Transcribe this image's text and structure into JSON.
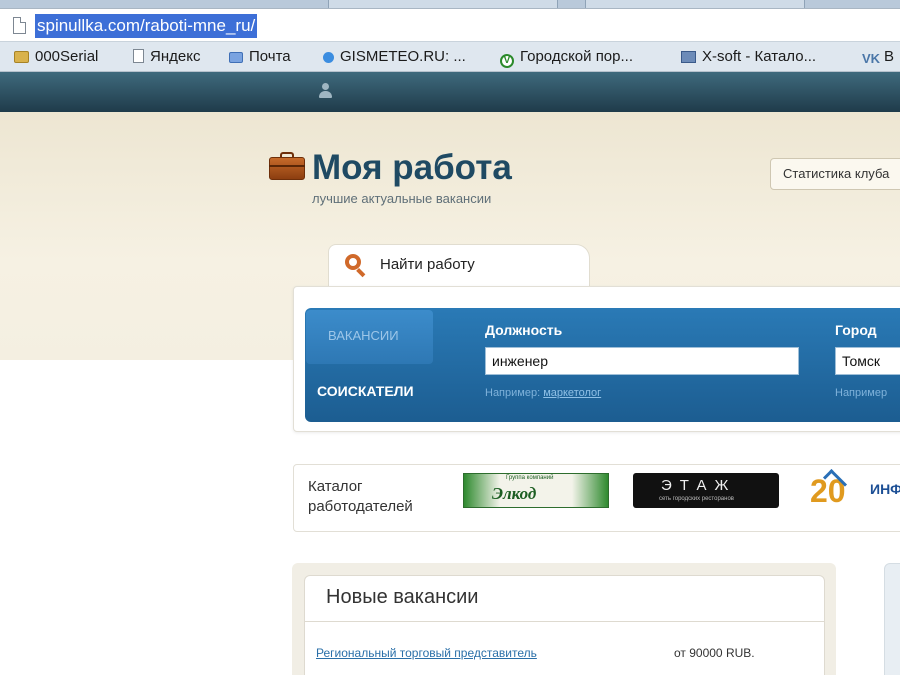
{
  "browser": {
    "url": "spinullka.com/raboti-mne_ru/",
    "bookmarks": [
      {
        "label": "000Serial",
        "icon": "folder-icon"
      },
      {
        "label": "Яндекс",
        "icon": "page-icon"
      },
      {
        "label": "Почта",
        "icon": "mail-icon"
      },
      {
        "label": "GISMETEO.RU: ...",
        "icon": "weather-icon"
      },
      {
        "label": "Городской пор...",
        "icon": "city-portal-icon"
      },
      {
        "label": "X-soft - Катало...",
        "icon": "xsoft-icon"
      },
      {
        "label": "В",
        "icon": "vk-icon"
      }
    ]
  },
  "header": {
    "logo_title": "Моя работа",
    "logo_subtitle": "лучшие актуальные вакансии",
    "stats_button": "Статистика клуба"
  },
  "search": {
    "tab_label": "Найти работу",
    "mode_tabs": {
      "vacancies": "ВАКАНСИИ",
      "seekers": "СОИСКАТЕЛИ"
    },
    "position_label": "Должность",
    "position_value": "инженер",
    "position_hint_prefix": "Например:",
    "position_hint_link": "маркетолог",
    "city_label": "Город",
    "city_value": "Томск",
    "city_hint_prefix": "Например"
  },
  "catalog": {
    "label_line1": "Каталог",
    "label_line2": "работодателей",
    "logos": {
      "elkod": {
        "text": "Элкод",
        "small": "Группа компаний"
      },
      "etaz": {
        "text": "ЭТАЖ",
        "small": "сеть городских ресторанов"
      },
      "inf": {
        "number": "20",
        "word": "ИНФ"
      }
    }
  },
  "vacancies": {
    "title": "Новые вакансии",
    "items": [
      {
        "title": "Региональный торговый представитель",
        "salary": "от 90000 RUB."
      }
    ]
  },
  "colors": {
    "site_bar": "#1f3b4a",
    "search_box": "#2a7ab6",
    "logo_text": "#1f4a63",
    "accent_orange": "#d0692a"
  }
}
